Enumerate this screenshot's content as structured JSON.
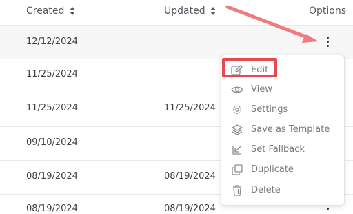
{
  "table": {
    "columns": {
      "created": "Created",
      "updated": "Updated",
      "options": "Options"
    },
    "rows": [
      {
        "created": "12/12/2024",
        "updated": ""
      },
      {
        "created": "11/25/2024",
        "updated": ""
      },
      {
        "created": "11/25/2024",
        "updated": "11/25/2024"
      },
      {
        "created": "09/10/2024",
        "updated": ""
      },
      {
        "created": "08/19/2024",
        "updated": "08/19/2024"
      },
      {
        "created": "08/19/2024",
        "updated": "08/19/2024"
      }
    ]
  },
  "menu": {
    "items": [
      {
        "label": "Edit",
        "icon": "pencil-square-icon"
      },
      {
        "label": "View",
        "icon": "eye-icon"
      },
      {
        "label": "Settings",
        "icon": "gear-icon"
      },
      {
        "label": "Save as Template",
        "icon": "layers-icon"
      },
      {
        "label": "Set Fallback",
        "icon": "arrow-down-left-icon"
      },
      {
        "label": "Duplicate",
        "icon": "copy-icon"
      },
      {
        "label": "Delete",
        "icon": "trash-icon"
      }
    ]
  },
  "colors": {
    "annotation": "#e8484d",
    "divider": "#e9eaec",
    "text": "#3f4146",
    "muted_text": "#777b80"
  }
}
